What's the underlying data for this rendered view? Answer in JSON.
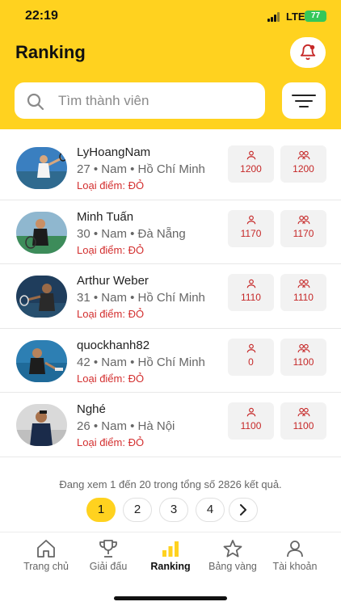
{
  "status_bar": {
    "time": "22:19",
    "network": "LTE",
    "battery": "77"
  },
  "header": {
    "title": "Ranking",
    "search_placeholder": "Tìm thành viên"
  },
  "players": [
    {
      "name": "LyHoangNam",
      "meta": "27 • Nam • Hồ Chí Minh",
      "points_type": "Loại điểm: ĐỎ",
      "single_points": "1200",
      "double_points": "1200"
    },
    {
      "name": "Minh Tuấn",
      "meta": "30 • Nam • Đà Nẵng",
      "points_type": "Loại điểm: ĐỎ",
      "single_points": "1170",
      "double_points": "1170"
    },
    {
      "name": "Arthur Weber",
      "meta": "31 • Nam • Hồ Chí Minh",
      "points_type": "Loại điểm: ĐỎ",
      "single_points": "1110",
      "double_points": "1110"
    },
    {
      "name": "quockhanh82",
      "meta": "42 • Nam • Hồ Chí Minh",
      "points_type": "Loại điểm: ĐỎ",
      "single_points": "0",
      "double_points": "1100"
    },
    {
      "name": "Nghé",
      "meta": "26 • Nam • Hà Nội",
      "points_type": "Loại điểm: ĐỎ",
      "single_points": "1100",
      "double_points": "1100"
    }
  ],
  "pagination": {
    "info": "Đang xem 1 đến 20 trong tổng số 2826 kết quả.",
    "pages": [
      "1",
      "2",
      "3",
      "4"
    ],
    "current": "1"
  },
  "tabs": [
    {
      "label": "Trang chủ",
      "icon": "home-icon"
    },
    {
      "label": "Giải đấu",
      "icon": "trophy-icon"
    },
    {
      "label": "Ranking",
      "icon": "bar-chart-icon",
      "active": true
    },
    {
      "label": "Bảng vàng",
      "icon": "star-icon"
    },
    {
      "label": "Tài khoản",
      "icon": "user-icon"
    }
  ],
  "colors": {
    "accent": "#FFD21F",
    "points_red": "#C62828",
    "battery_green": "#34C759"
  }
}
